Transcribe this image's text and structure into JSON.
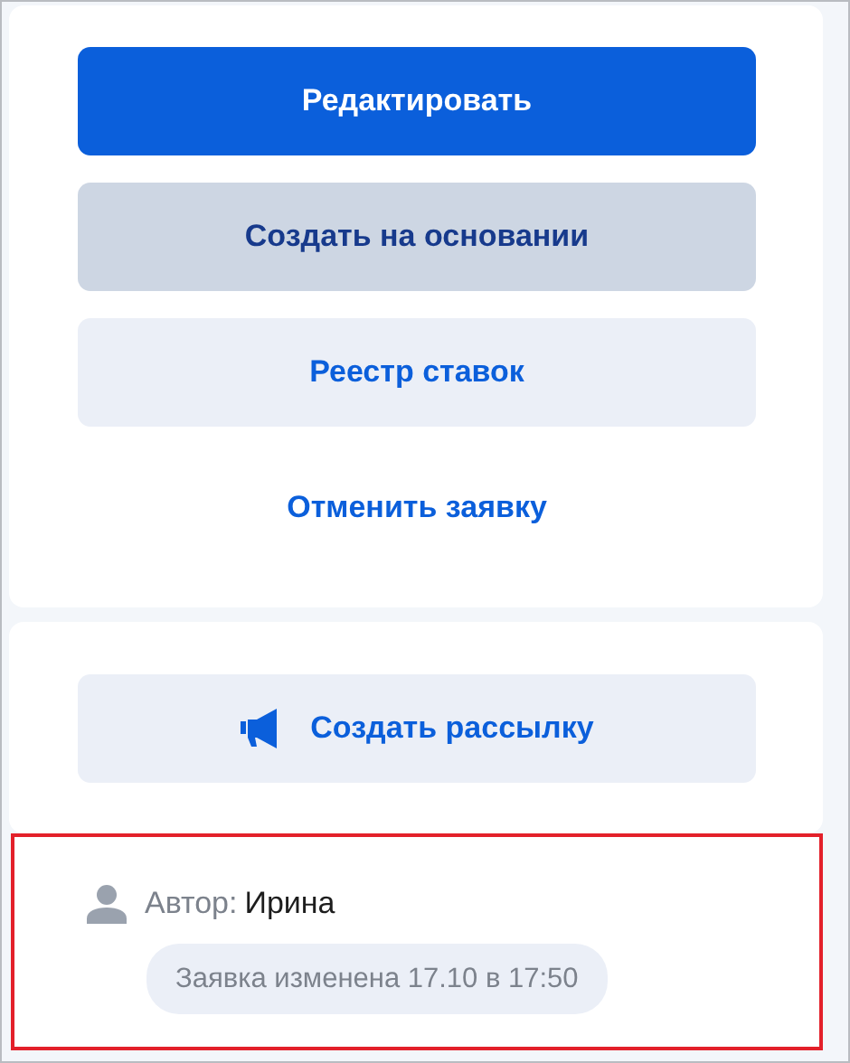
{
  "actions": [
    {
      "label": "Редактировать",
      "kind": "primary"
    },
    {
      "label": "Создать на основании",
      "kind": "secondary"
    },
    {
      "label": "Реестр ставок",
      "kind": "light"
    },
    {
      "label": "Отменить заявку",
      "kind": "link"
    }
  ],
  "mailing": {
    "label": "Создать рассылку",
    "kind": "light"
  },
  "author": {
    "highlighted": true,
    "label": "Автор:",
    "name": "Ирина",
    "changed": "Заявка изменена 17.10 в 17:50"
  }
}
